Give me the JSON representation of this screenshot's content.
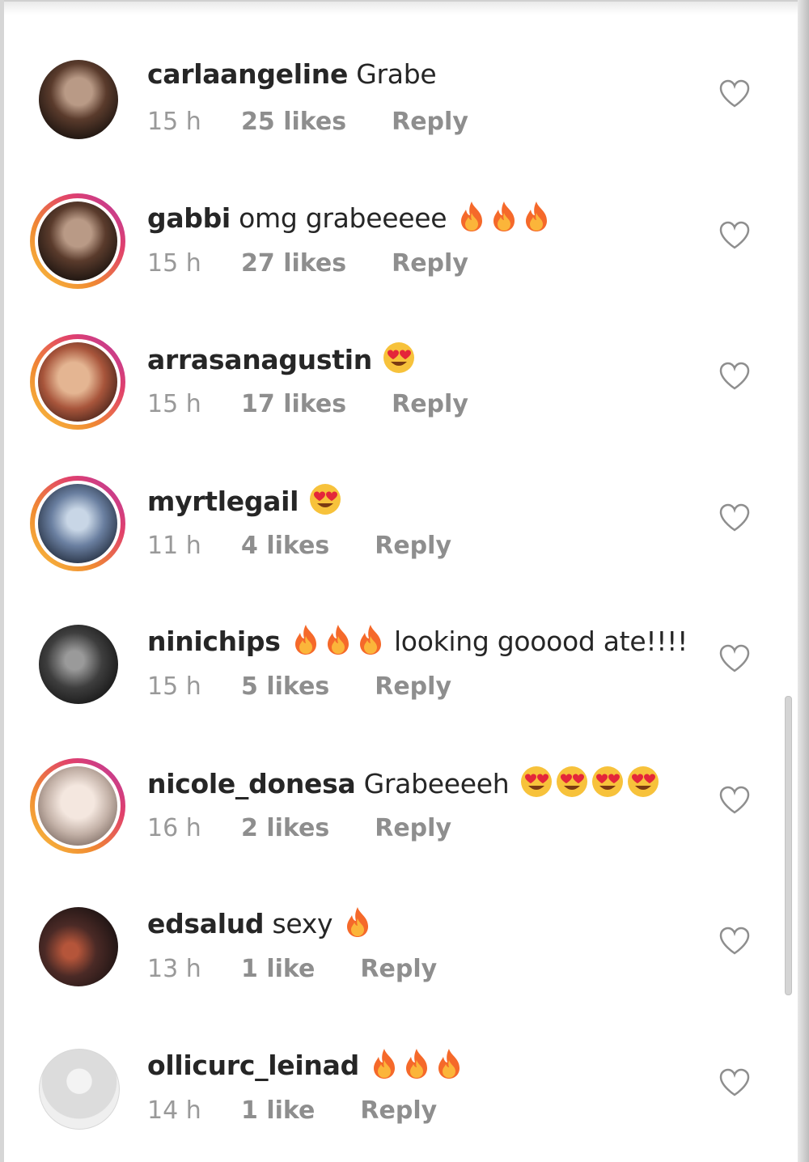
{
  "comments": [
    {
      "username": "carlaangeline",
      "text": "Grabe",
      "emojis": [],
      "time": "15 h",
      "likes": "25 likes",
      "reply": "Reply",
      "story_ring": false,
      "avatar": "dark"
    },
    {
      "username": "gabbi",
      "text": "omg grabeeeee",
      "emojis": [
        "fire",
        "fire",
        "fire"
      ],
      "time": "15 h",
      "likes": "27 likes",
      "reply": "Reply",
      "story_ring": true,
      "avatar": "dark"
    },
    {
      "username": "arrasanagustin",
      "text": "",
      "emojis": [
        "heart-eyes"
      ],
      "time": "15 h",
      "likes": "17 likes",
      "reply": "Reply",
      "story_ring": true,
      "avatar": "warm"
    },
    {
      "username": "myrtlegail",
      "text": "",
      "emojis": [
        "heart-eyes"
      ],
      "time": "11 h",
      "likes": "4 likes",
      "reply": "Reply",
      "story_ring": true,
      "avatar": "cool"
    },
    {
      "username": "ninichips",
      "text": "looking gooood ate!!!!",
      "emojis_before": [
        "fire",
        "fire",
        "fire"
      ],
      "emojis": [],
      "time": "15 h",
      "likes": "5 likes",
      "reply": "Reply",
      "story_ring": false,
      "avatar": "bw"
    },
    {
      "username": "nicole_donesa",
      "text": "Grabeeeeh",
      "emojis": [
        "heart-eyes",
        "heart-eyes",
        "heart-eyes",
        "heart-eyes"
      ],
      "time": "16 h",
      "likes": "2 likes",
      "reply": "Reply",
      "story_ring": true,
      "avatar": "light"
    },
    {
      "username": "edsalud",
      "text": "sexy",
      "emojis": [
        "fire"
      ],
      "time": "13 h",
      "likes": "1 like",
      "reply": "Reply",
      "story_ring": false,
      "avatar": "night"
    },
    {
      "username": "ollicurc_leinad",
      "text": "",
      "emojis": [
        "fire",
        "fire",
        "fire"
      ],
      "time": "14 h",
      "likes": "1 like",
      "reply": "Reply",
      "story_ring": false,
      "avatar": "default"
    }
  ],
  "colors": {
    "text": "#262626",
    "meta": "#8e8e8e",
    "story_ring_start": "#f9c33f",
    "story_ring_end": "#b43aa6"
  }
}
